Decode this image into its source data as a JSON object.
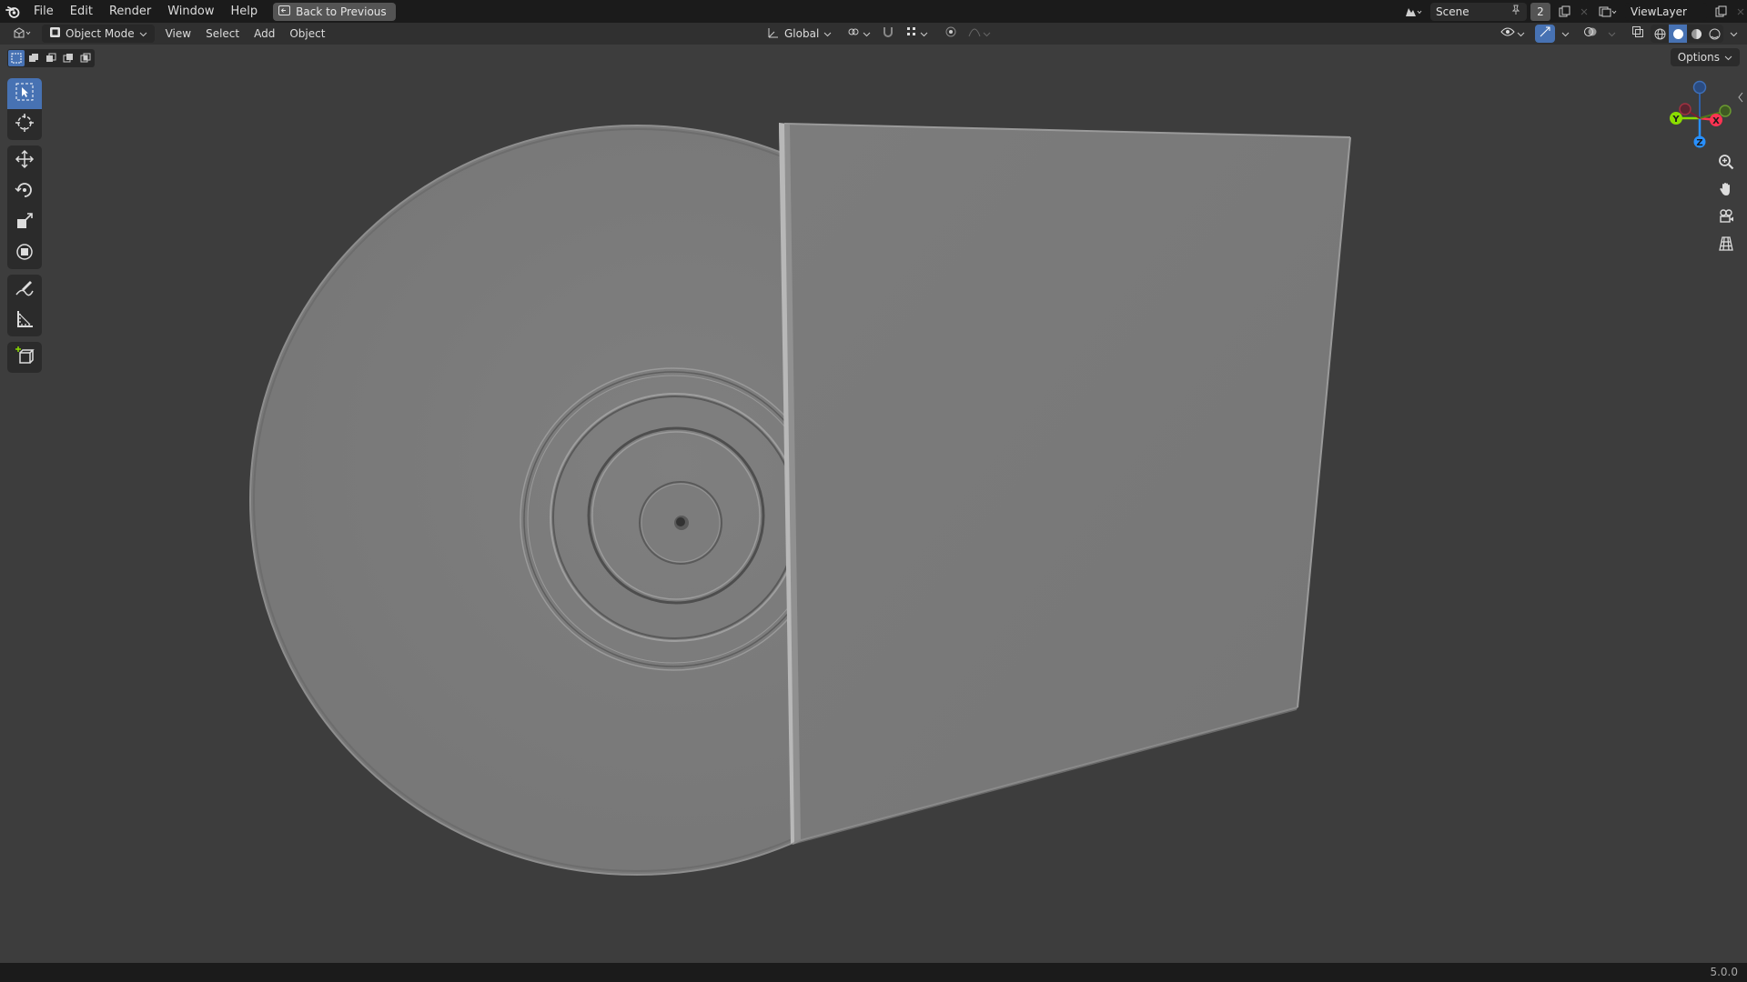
{
  "topbar": {
    "menus": [
      "File",
      "Edit",
      "Render",
      "Window",
      "Help"
    ],
    "back_button": "Back to Previous",
    "scene_name": "Scene",
    "scene_users": "2",
    "view_layer": "ViewLayer"
  },
  "header": {
    "mode": "Object Mode",
    "menus": [
      "View",
      "Select",
      "Add",
      "Object"
    ],
    "transform_orientation": "Global"
  },
  "options_label": "Options",
  "gizmo": {
    "x_label": "X",
    "y_label": "Y",
    "z_label": "Z",
    "x_color": "#ff3352",
    "y_color": "#8bdc00",
    "z_color": "#2890ff"
  },
  "toolbar": {
    "tools": [
      "select-box-icon",
      "cursor-icon",
      "move-icon",
      "rotate-icon",
      "scale-icon",
      "transform-icon",
      "annotate-icon",
      "measure-icon",
      "add-cube-icon"
    ]
  },
  "accent_color": "#4772b3",
  "version": "5.0.0"
}
